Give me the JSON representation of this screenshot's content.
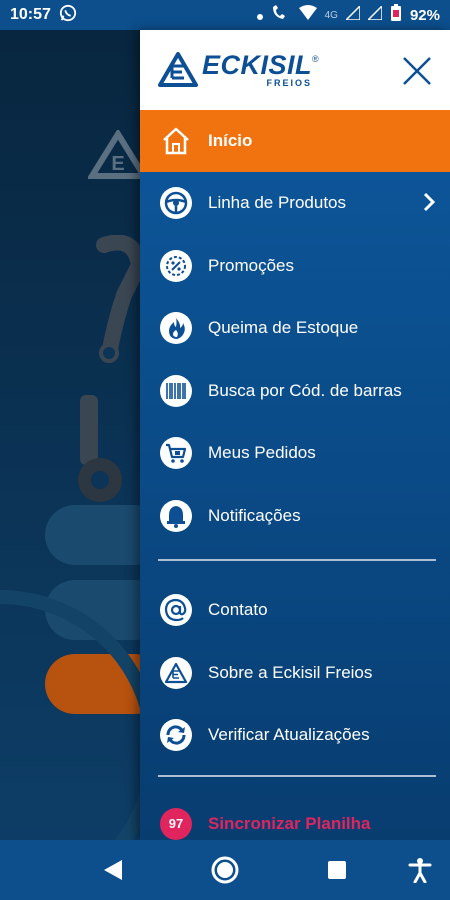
{
  "status_bar": {
    "time": "10:57",
    "network": "4G",
    "battery": "92%"
  },
  "header": {
    "brand_name": "ECKISIL",
    "brand_sub": "FREIOS",
    "registered_mark": "®"
  },
  "menu": {
    "items": [
      {
        "label": "Início",
        "icon": "home-icon",
        "active": true
      },
      {
        "label": "Linha de Produtos",
        "icon": "steering-wheel-icon",
        "has_submenu": true
      },
      {
        "label": "Promoções",
        "icon": "percent-gear-icon"
      },
      {
        "label": "Queima de Estoque",
        "icon": "flame-icon"
      },
      {
        "label": "Busca por Cód. de barras",
        "icon": "barcode-icon"
      },
      {
        "label": "Meus Pedidos",
        "icon": "cart-icon"
      },
      {
        "label": "Notificações",
        "icon": "bell-icon"
      }
    ],
    "secondary": [
      {
        "label": "Contato",
        "icon": "at-icon"
      },
      {
        "label": "Sobre a Eckisil Freios",
        "icon": "eckisil-logo-icon"
      },
      {
        "label": "Verificar Atualizações",
        "icon": "refresh-icon"
      }
    ],
    "sync": {
      "badge": "97",
      "label": "Sincronizar Planilha"
    }
  },
  "colors": {
    "accent": "#f07310",
    "drawer": "#0d5aa0",
    "brand": "#0d4f95",
    "sync": "#e0245e"
  }
}
